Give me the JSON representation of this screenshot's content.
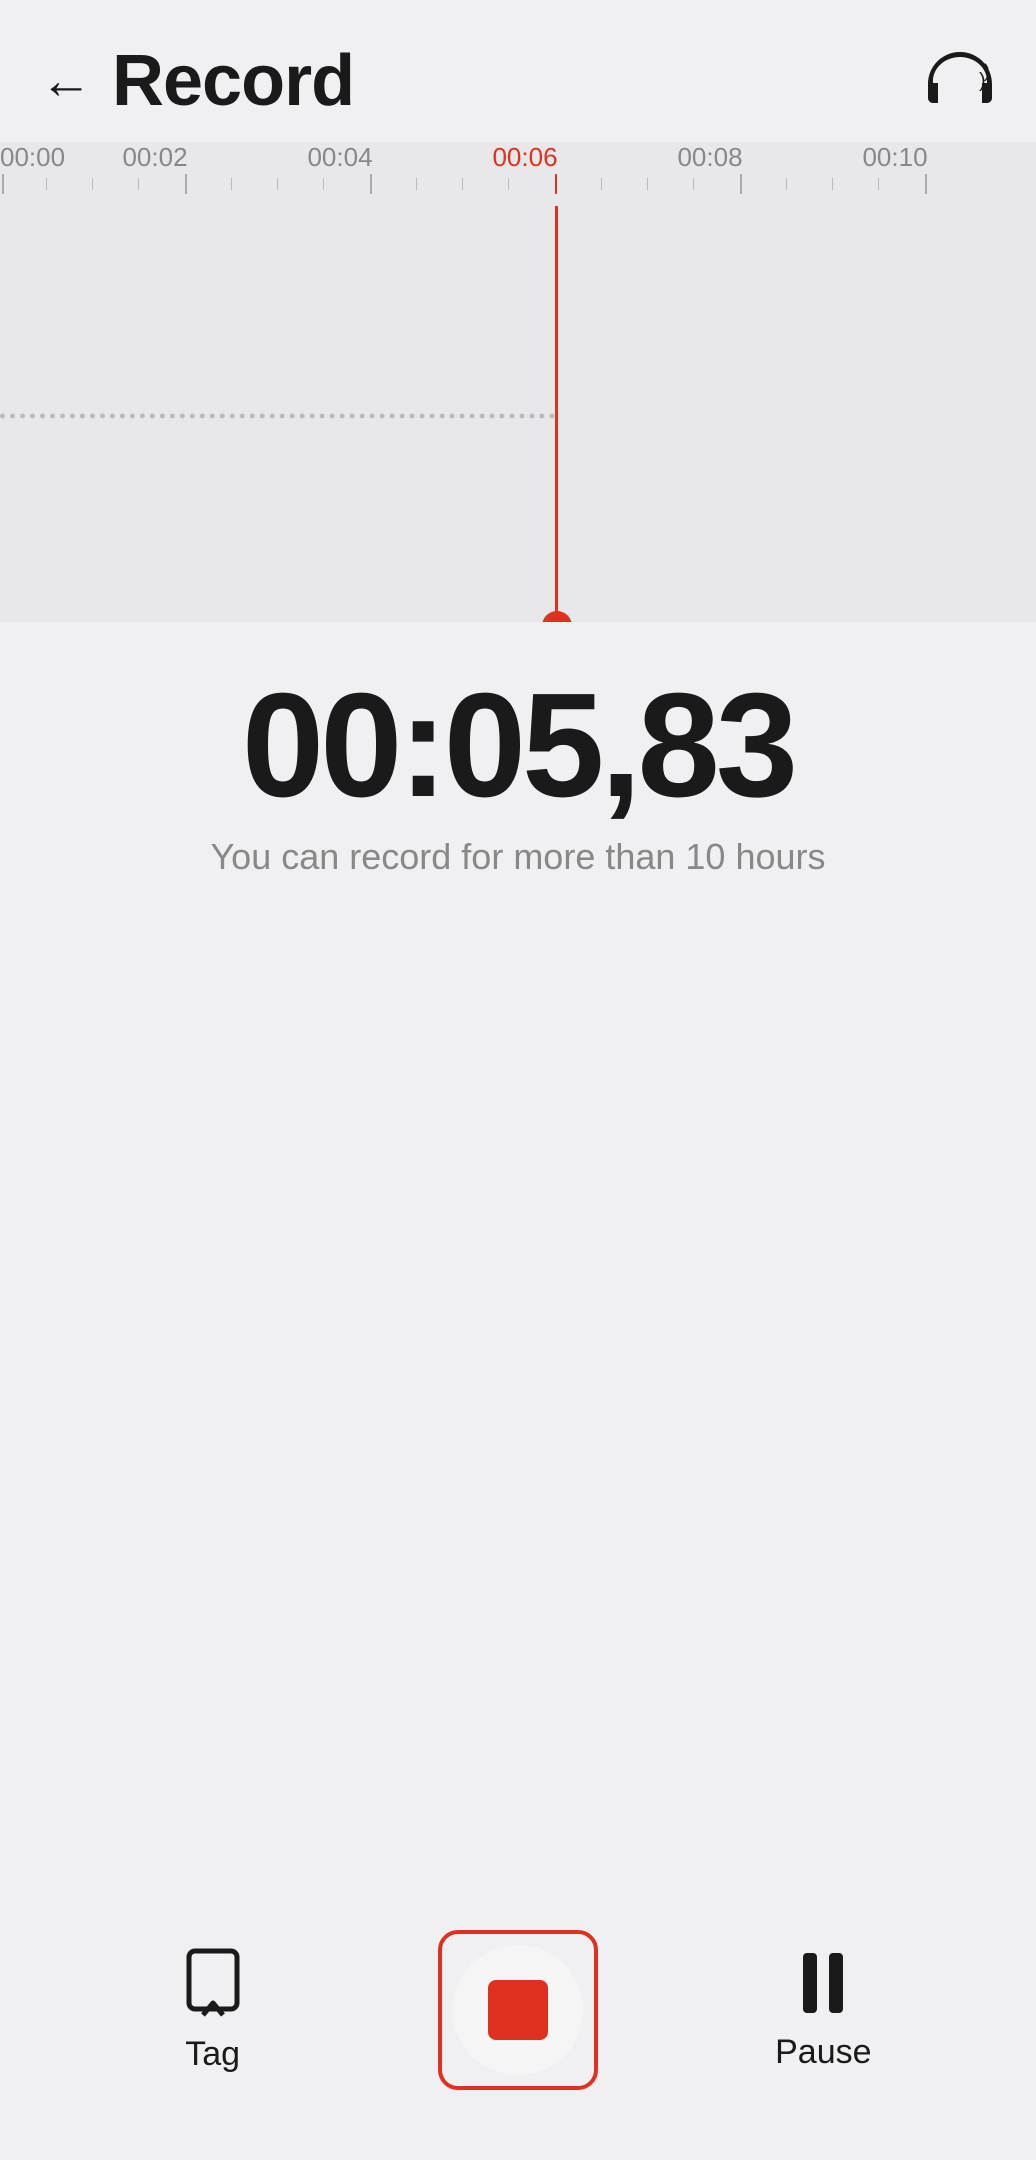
{
  "header": {
    "title": "Record",
    "back_label": "Back"
  },
  "ruler": {
    "labels": [
      "00:00",
      "00:02",
      "00:04",
      "00:06",
      "00:08",
      "00:10"
    ],
    "playhead_time": "00:06"
  },
  "time_display": {
    "time": "00:05,83",
    "info_text": "You can record for more than 10 hours"
  },
  "toolbar": {
    "tag_label": "Tag",
    "stop_label": "",
    "pause_label": "Pause"
  },
  "colors": {
    "accent": "#e03020",
    "text_primary": "#1a1a1a",
    "text_secondary": "#888888",
    "background": "#f0f0f2",
    "timeline_bg": "#e8e8ea"
  }
}
